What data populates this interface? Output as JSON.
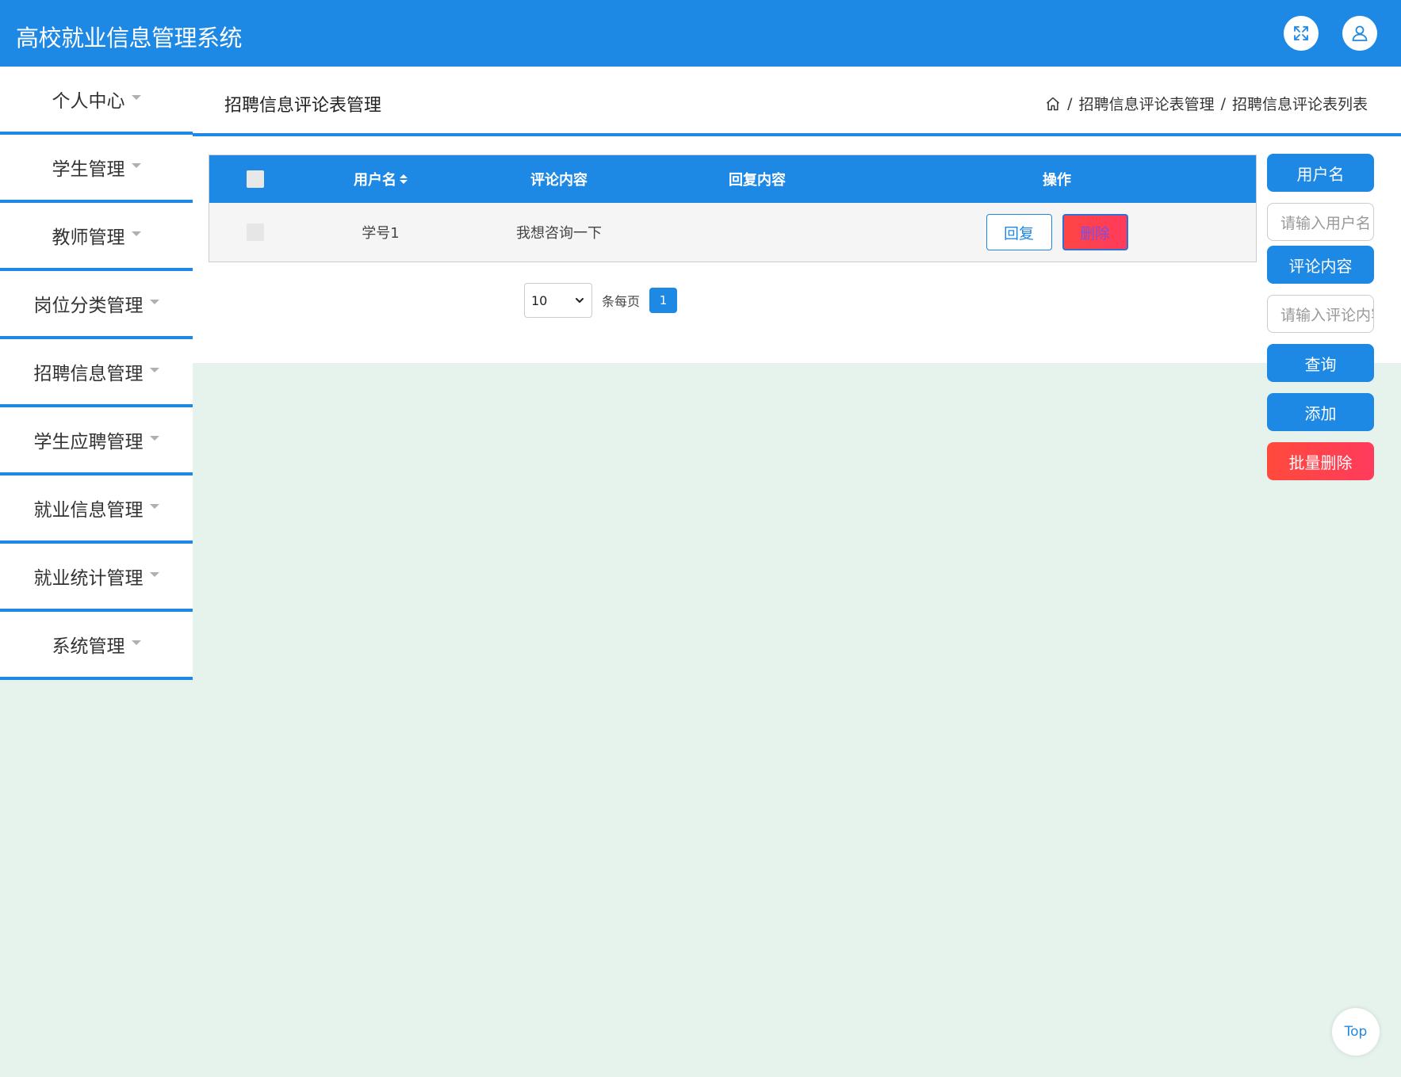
{
  "app": {
    "title": "高校就业信息管理系统"
  },
  "topbar": {
    "fullscreen_icon": "expand-icon",
    "user_icon": "user-icon"
  },
  "sidebar": {
    "items": [
      {
        "label": "个人中心"
      },
      {
        "label": "学生管理"
      },
      {
        "label": "教师管理"
      },
      {
        "label": "岗位分类管理"
      },
      {
        "label": "招聘信息管理"
      },
      {
        "label": "学生应聘管理"
      },
      {
        "label": "就业信息管理"
      },
      {
        "label": "就业统计管理"
      },
      {
        "label": "系统管理"
      }
    ]
  },
  "page": {
    "title": "招聘信息评论表管理",
    "breadcrumb": {
      "sep": "/",
      "level1": "招聘信息评论表管理",
      "level2": "招聘信息评论表列表"
    }
  },
  "table": {
    "headers": {
      "username": "用户名",
      "comment": "评论内容",
      "reply": "回复内容",
      "actions": "操作"
    },
    "rows": [
      {
        "username": "学号1",
        "comment": "我想咨询一下",
        "reply": "",
        "reply_btn": "回复",
        "delete_btn": "删除"
      }
    ]
  },
  "pager": {
    "page_size": "10",
    "per_page_label": "条每页",
    "current_page": "1"
  },
  "search": {
    "username_label": "用户名",
    "username_placeholder": "请输入用户名",
    "comment_label": "评论内容",
    "comment_placeholder": "请输入评论内容",
    "query_btn": "查询",
    "add_btn": "添加",
    "batch_delete_btn": "批量删除"
  },
  "back_to_top": "Top",
  "colors": {
    "primary": "#1e88e5",
    "danger": "#ff4545",
    "background": "#e6f3ec"
  }
}
